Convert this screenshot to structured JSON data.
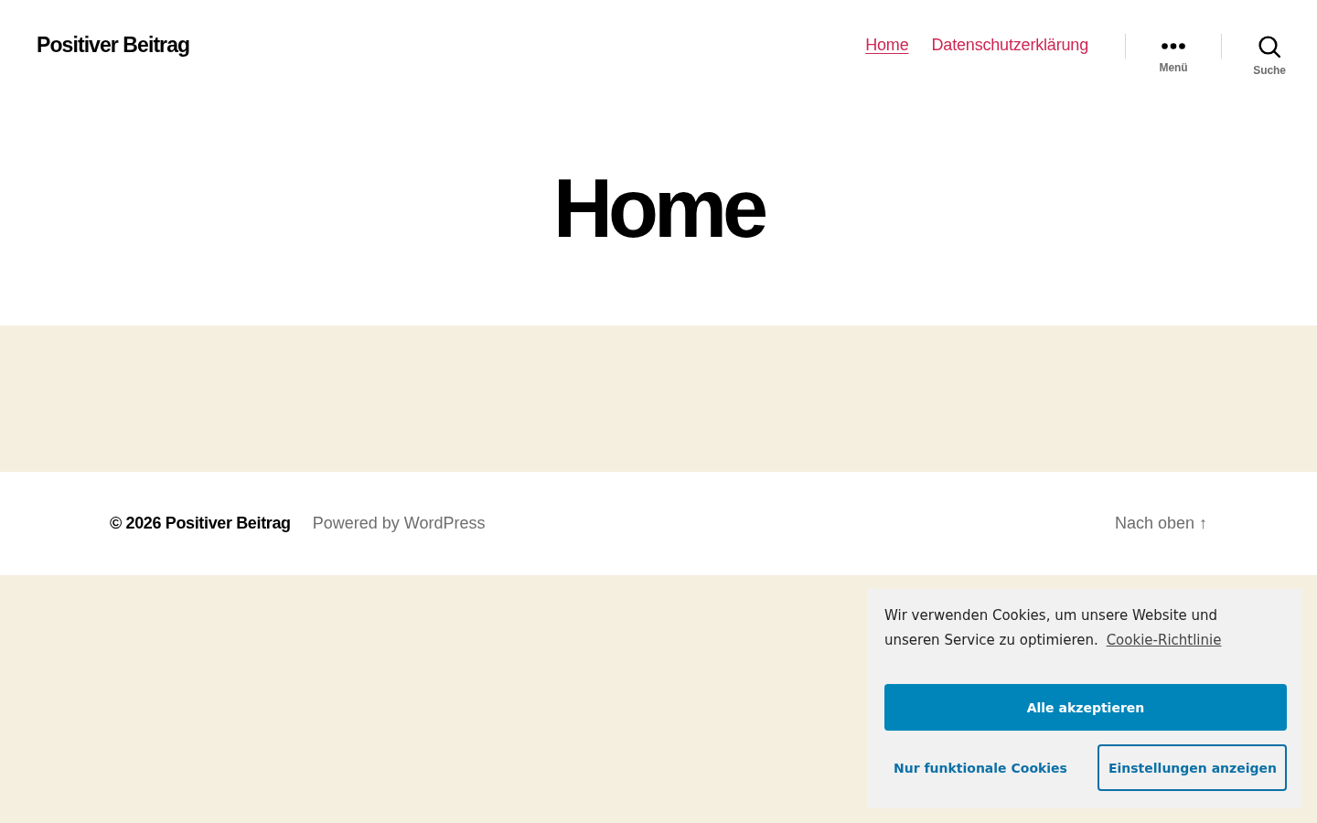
{
  "header": {
    "site_title": "Positiver Beitrag",
    "nav": [
      {
        "label": "Home",
        "selected": true
      },
      {
        "label": "Datenschutzerklärung",
        "selected": false
      }
    ],
    "toggles": [
      {
        "kind": "menu",
        "label": "Menü"
      },
      {
        "kind": "search",
        "label": "Suche"
      }
    ]
  },
  "page_title": "Home",
  "footer": {
    "copyright": "© 2026 Positiver Beitrag",
    "powered_by": "Powered by WordPress",
    "back_to_top": "Nach oben ↑"
  },
  "cookie_banner": {
    "message": "Wir verwenden Cookies, um unsere Website und unseren Service zu optimieren.",
    "policy_link": "Cookie-Richtlinie",
    "buttons": [
      {
        "kind": "primary",
        "label": "Alle akzeptieren"
      },
      {
        "kind": "text",
        "label": "Nur funktionale Cookies"
      },
      {
        "kind": "outline",
        "label": "Einstellungen anzeigen"
      }
    ]
  }
}
